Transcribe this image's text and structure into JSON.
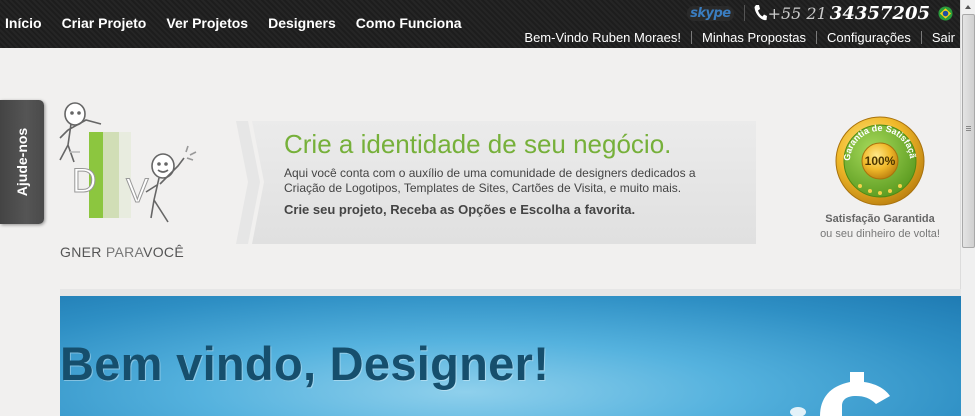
{
  "nav": {
    "items": [
      "Início",
      "Criar Projeto",
      "Ver Projetos",
      "Designers",
      "Como Funciona"
    ]
  },
  "contact": {
    "skype_label": "skype",
    "phone_prefix": "+55 21",
    "phone_number": "34357205",
    "flag_icon": "brazil-flag-icon"
  },
  "user_menu": {
    "welcome": "Bem-Vindo Ruben Moraes!",
    "items": [
      "Minhas Propostas",
      "Configurações",
      "Sair"
    ]
  },
  "side_tab": {
    "label": "Ajude-nos"
  },
  "logo": {
    "letters": "DV",
    "text_dark": "GNER",
    "text_light": "PARA",
    "text_dark2": "VOCÊ"
  },
  "banner": {
    "title": "Crie a identidade de seu negócio.",
    "description": "Aqui você conta com o auxílio de uma comunidade de designers dedicados a Criação de Logotipos, Templates de Sites, Cartões de Visita, e muito mais.",
    "cta": "Crie seu projeto, Receba as Opções e Escolha a favorita."
  },
  "seal": {
    "ring_text": "Garantia de Satisfação",
    "percent": "100%",
    "title": "Satisfação Garantida",
    "subtitle": "ou seu dinheiro de volta!"
  },
  "hero": {
    "title": "Bem vindo, Designer!"
  },
  "colors": {
    "accent_green": "#76b03a",
    "topbar": "#1d1d1d",
    "hero_blue": "#2e8fc4",
    "hero_text": "#164f6d"
  }
}
